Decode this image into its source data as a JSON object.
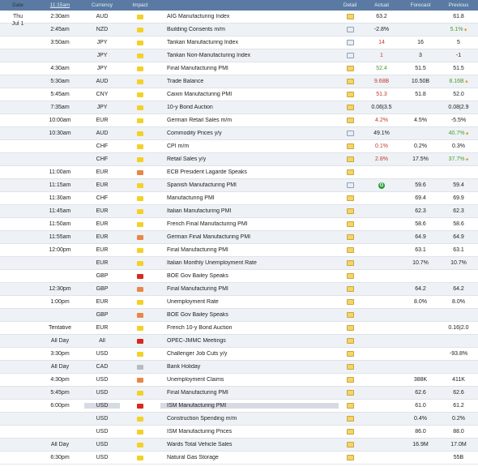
{
  "header": {
    "date": "Date",
    "time": "11:15am",
    "currency": "Currency",
    "impact": "Impact",
    "event": "",
    "detail": "Detail",
    "actual": "Actual",
    "forecast": "Forecast",
    "previous": "Previous"
  },
  "date_label": {
    "day": "Thu",
    "date": "Jul 1"
  },
  "colors": {
    "header_bg": "#5a7aa4",
    "red": "#c0392b",
    "green": "#4a9c2c",
    "impact_yellow": "#f3d12a",
    "impact_orange": "#e8874a",
    "impact_red": "#d62a1e",
    "impact_gray": "#b8bcc2"
  },
  "rows": [
    {
      "time": "2:30am",
      "currency": "AUD",
      "impact": "yellow",
      "event": "AIG Manufacturing Index",
      "detail": "folder",
      "actual": "63.2",
      "actual_color": "",
      "forecast": "",
      "previous": "61.8",
      "previous_color": "",
      "prev_arrow": false
    },
    {
      "time": "2:45am",
      "currency": "NZD",
      "impact": "yellow",
      "event": "Building Consents m/m",
      "detail": "doc",
      "actual": "-2.8%",
      "actual_color": "",
      "forecast": "",
      "previous": "5.1%",
      "previous_color": "green",
      "prev_arrow": true
    },
    {
      "time": "3:50am",
      "currency": "JPY",
      "impact": "yellow",
      "event": "Tankan Manufacturing Index",
      "detail": "doc",
      "actual": "14",
      "actual_color": "red",
      "forecast": "16",
      "previous": "5",
      "previous_color": "",
      "prev_arrow": false
    },
    {
      "time": "",
      "currency": "JPY",
      "impact": "yellow",
      "event": "Tankan Non-Manufacturing Index",
      "detail": "doc",
      "actual": "1",
      "actual_color": "red",
      "forecast": "3",
      "previous": "-1",
      "previous_color": "",
      "prev_arrow": false
    },
    {
      "time": "4:30am",
      "currency": "JPY",
      "impact": "yellow",
      "event": "Final Manufacturing PMI",
      "detail": "folder",
      "actual": "52.4",
      "actual_color": "green",
      "forecast": "51.5",
      "previous": "51.5",
      "previous_color": "",
      "prev_arrow": false
    },
    {
      "time": "5:30am",
      "currency": "AUD",
      "impact": "yellow",
      "event": "Trade Balance",
      "detail": "folder",
      "actual": "9.68B",
      "actual_color": "red",
      "forecast": "10.50B",
      "previous": "8.16B",
      "previous_color": "green",
      "prev_arrow": true
    },
    {
      "time": "5:45am",
      "currency": "CNY",
      "impact": "yellow",
      "event": "Caixin Manufacturing PMI",
      "detail": "folder",
      "actual": "51.3",
      "actual_color": "red",
      "forecast": "51.8",
      "previous": "52.0",
      "previous_color": "",
      "prev_arrow": false
    },
    {
      "time": "7:35am",
      "currency": "JPY",
      "impact": "yellow",
      "event": "10-y Bond Auction",
      "detail": "folder",
      "actual": "0.06|3.5",
      "actual_color": "",
      "forecast": "",
      "previous": "0.08|2.9",
      "previous_color": "",
      "prev_arrow": false
    },
    {
      "time": "10:00am",
      "currency": "EUR",
      "impact": "yellow",
      "event": "German Retail Sales m/m",
      "detail": "folder",
      "actual": "4.2%",
      "actual_color": "red",
      "forecast": "4.5%",
      "previous": "-5.5%",
      "previous_color": "",
      "prev_arrow": false
    },
    {
      "time": "10:30am",
      "currency": "AUD",
      "impact": "yellow",
      "event": "Commodity Prices y/y",
      "detail": "doc",
      "actual": "49.1%",
      "actual_color": "",
      "forecast": "",
      "previous": "40.7%",
      "previous_color": "green",
      "prev_arrow": true
    },
    {
      "time": "",
      "currency": "CHF",
      "impact": "yellow",
      "event": "CPI m/m",
      "detail": "folder",
      "actual": "0.1%",
      "actual_color": "red",
      "forecast": "0.2%",
      "previous": "0.3%",
      "previous_color": "",
      "prev_arrow": false
    },
    {
      "time": "",
      "currency": "CHF",
      "impact": "yellow",
      "event": "Retail Sales y/y",
      "detail": "folder",
      "actual": "2.8%",
      "actual_color": "red",
      "forecast": "17.5%",
      "previous": "37.7%",
      "previous_color": "green",
      "prev_arrow": true
    },
    {
      "time": "11:00am",
      "currency": "EUR",
      "impact": "orange",
      "event": "ECB President Lagarde Speaks",
      "detail": "folder",
      "actual": "",
      "actual_color": "",
      "forecast": "",
      "previous": "",
      "previous_color": "",
      "prev_arrow": false
    },
    {
      "time": "11:15am",
      "currency": "EUR",
      "impact": "yellow",
      "event": "Spanish Manufacturing PMI",
      "detail": "doc",
      "actual": "G",
      "actual_color": "gicon",
      "forecast": "59.6",
      "previous": "59.4",
      "previous_color": "",
      "prev_arrow": false
    },
    {
      "time": "11:30am",
      "currency": "CHF",
      "impact": "yellow",
      "event": "Manufacturing PMI",
      "detail": "folder",
      "actual": "",
      "actual_color": "",
      "forecast": "69.4",
      "previous": "69.9",
      "previous_color": "",
      "prev_arrow": false
    },
    {
      "time": "11:45am",
      "currency": "EUR",
      "impact": "yellow",
      "event": "Italian Manufacturing PMI",
      "detail": "folder",
      "actual": "",
      "actual_color": "",
      "forecast": "62.3",
      "previous": "62.3",
      "previous_color": "",
      "prev_arrow": false
    },
    {
      "time": "11:50am",
      "currency": "EUR",
      "impact": "yellow",
      "event": "French Final Manufacturing PMI",
      "detail": "folder",
      "actual": "",
      "actual_color": "",
      "forecast": "58.6",
      "previous": "58.6",
      "previous_color": "",
      "prev_arrow": false
    },
    {
      "time": "11:55am",
      "currency": "EUR",
      "impact": "orange",
      "event": "German Final Manufacturing PMI",
      "detail": "folder",
      "actual": "",
      "actual_color": "",
      "forecast": "64.9",
      "previous": "64.9",
      "previous_color": "",
      "prev_arrow": false
    },
    {
      "time": "12:00pm",
      "currency": "EUR",
      "impact": "yellow",
      "event": "Final Manufacturing PMI",
      "detail": "folder",
      "actual": "",
      "actual_color": "",
      "forecast": "63.1",
      "previous": "63.1",
      "previous_color": "",
      "prev_arrow": false
    },
    {
      "time": "",
      "currency": "EUR",
      "impact": "yellow",
      "event": "Italian Monthly Unemployment Rate",
      "detail": "folder",
      "actual": "",
      "actual_color": "",
      "forecast": "10.7%",
      "previous": "10.7%",
      "previous_color": "",
      "prev_arrow": false
    },
    {
      "time": "",
      "currency": "GBP",
      "impact": "red",
      "event": "BOE Gov Bailey Speaks",
      "detail": "folder",
      "actual": "",
      "actual_color": "",
      "forecast": "",
      "previous": "",
      "previous_color": "",
      "prev_arrow": false
    },
    {
      "time": "12:30pm",
      "currency": "GBP",
      "impact": "orange",
      "event": "Final Manufacturing PMI",
      "detail": "folder",
      "actual": "",
      "actual_color": "",
      "forecast": "64.2",
      "previous": "64.2",
      "previous_color": "",
      "prev_arrow": false
    },
    {
      "time": "1:00pm",
      "currency": "EUR",
      "impact": "yellow",
      "event": "Unemployment Rate",
      "detail": "folder",
      "actual": "",
      "actual_color": "",
      "forecast": "8.0%",
      "previous": "8.0%",
      "previous_color": "",
      "prev_arrow": false
    },
    {
      "time": "",
      "currency": "GBP",
      "impact": "orange",
      "event": "BOE Gov Bailey Speaks",
      "detail": "folder",
      "actual": "",
      "actual_color": "",
      "forecast": "",
      "previous": "",
      "previous_color": "",
      "prev_arrow": false
    },
    {
      "time": "Tentative",
      "currency": "EUR",
      "impact": "yellow",
      "event": "French 10-y Bond Auction",
      "detail": "folder",
      "actual": "",
      "actual_color": "",
      "forecast": "",
      "previous": "0.16|2.0",
      "previous_color": "",
      "prev_arrow": false
    },
    {
      "time": "All Day",
      "currency": "All",
      "impact": "red",
      "event": "OPEC-JMMC Meetings",
      "detail": "folder",
      "actual": "",
      "actual_color": "",
      "forecast": "",
      "previous": "",
      "previous_color": "",
      "prev_arrow": false
    },
    {
      "time": "3:30pm",
      "currency": "USD",
      "impact": "yellow",
      "event": "Challenger Job Cuts y/y",
      "detail": "folder",
      "actual": "",
      "actual_color": "",
      "forecast": "",
      "previous": "-93.8%",
      "previous_color": "",
      "prev_arrow": false
    },
    {
      "time": "All Day",
      "currency": "CAD",
      "impact": "gray",
      "event": "Bank Holiday",
      "detail": "folder",
      "actual": "",
      "actual_color": "",
      "forecast": "",
      "previous": "",
      "previous_color": "",
      "prev_arrow": false
    },
    {
      "time": "4:30pm",
      "currency": "USD",
      "impact": "orange",
      "event": "Unemployment Claims",
      "detail": "folder",
      "actual": "",
      "actual_color": "",
      "forecast": "388K",
      "previous": "411K",
      "previous_color": "",
      "prev_arrow": false
    },
    {
      "time": "5:45pm",
      "currency": "USD",
      "impact": "yellow",
      "event": "Final Manufacturing PMI",
      "detail": "folder",
      "actual": "",
      "actual_color": "",
      "forecast": "62.6",
      "previous": "62.6",
      "previous_color": "",
      "prev_arrow": false
    },
    {
      "time": "6:00pm",
      "currency": "USD",
      "impact": "red",
      "event": "ISM Manufacturing PMI",
      "detail": "folder",
      "actual": "",
      "actual_color": "",
      "forecast": "61.0",
      "previous": "61.2",
      "previous_color": "",
      "prev_arrow": false,
      "highlight": true
    },
    {
      "time": "",
      "currency": "USD",
      "impact": "yellow",
      "event": "Construction Spending m/m",
      "detail": "folder",
      "actual": "",
      "actual_color": "",
      "forecast": "0.4%",
      "previous": "0.2%",
      "previous_color": "",
      "prev_arrow": false
    },
    {
      "time": "",
      "currency": "USD",
      "impact": "yellow",
      "event": "ISM Manufacturing Prices",
      "detail": "folder",
      "actual": "",
      "actual_color": "",
      "forecast": "86.0",
      "previous": "88.0",
      "previous_color": "",
      "prev_arrow": false
    },
    {
      "time": "All Day",
      "currency": "USD",
      "impact": "yellow",
      "event": "Wards Total Vehicle Sales",
      "detail": "folder",
      "actual": "",
      "actual_color": "",
      "forecast": "16.9M",
      "previous": "17.0M",
      "previous_color": "",
      "prev_arrow": false
    },
    {
      "time": "6:30pm",
      "currency": "USD",
      "impact": "yellow",
      "event": "Natural Gas Storage",
      "detail": "folder",
      "actual": "",
      "actual_color": "",
      "forecast": "",
      "previous": "55B",
      "previous_color": "",
      "prev_arrow": false
    }
  ]
}
